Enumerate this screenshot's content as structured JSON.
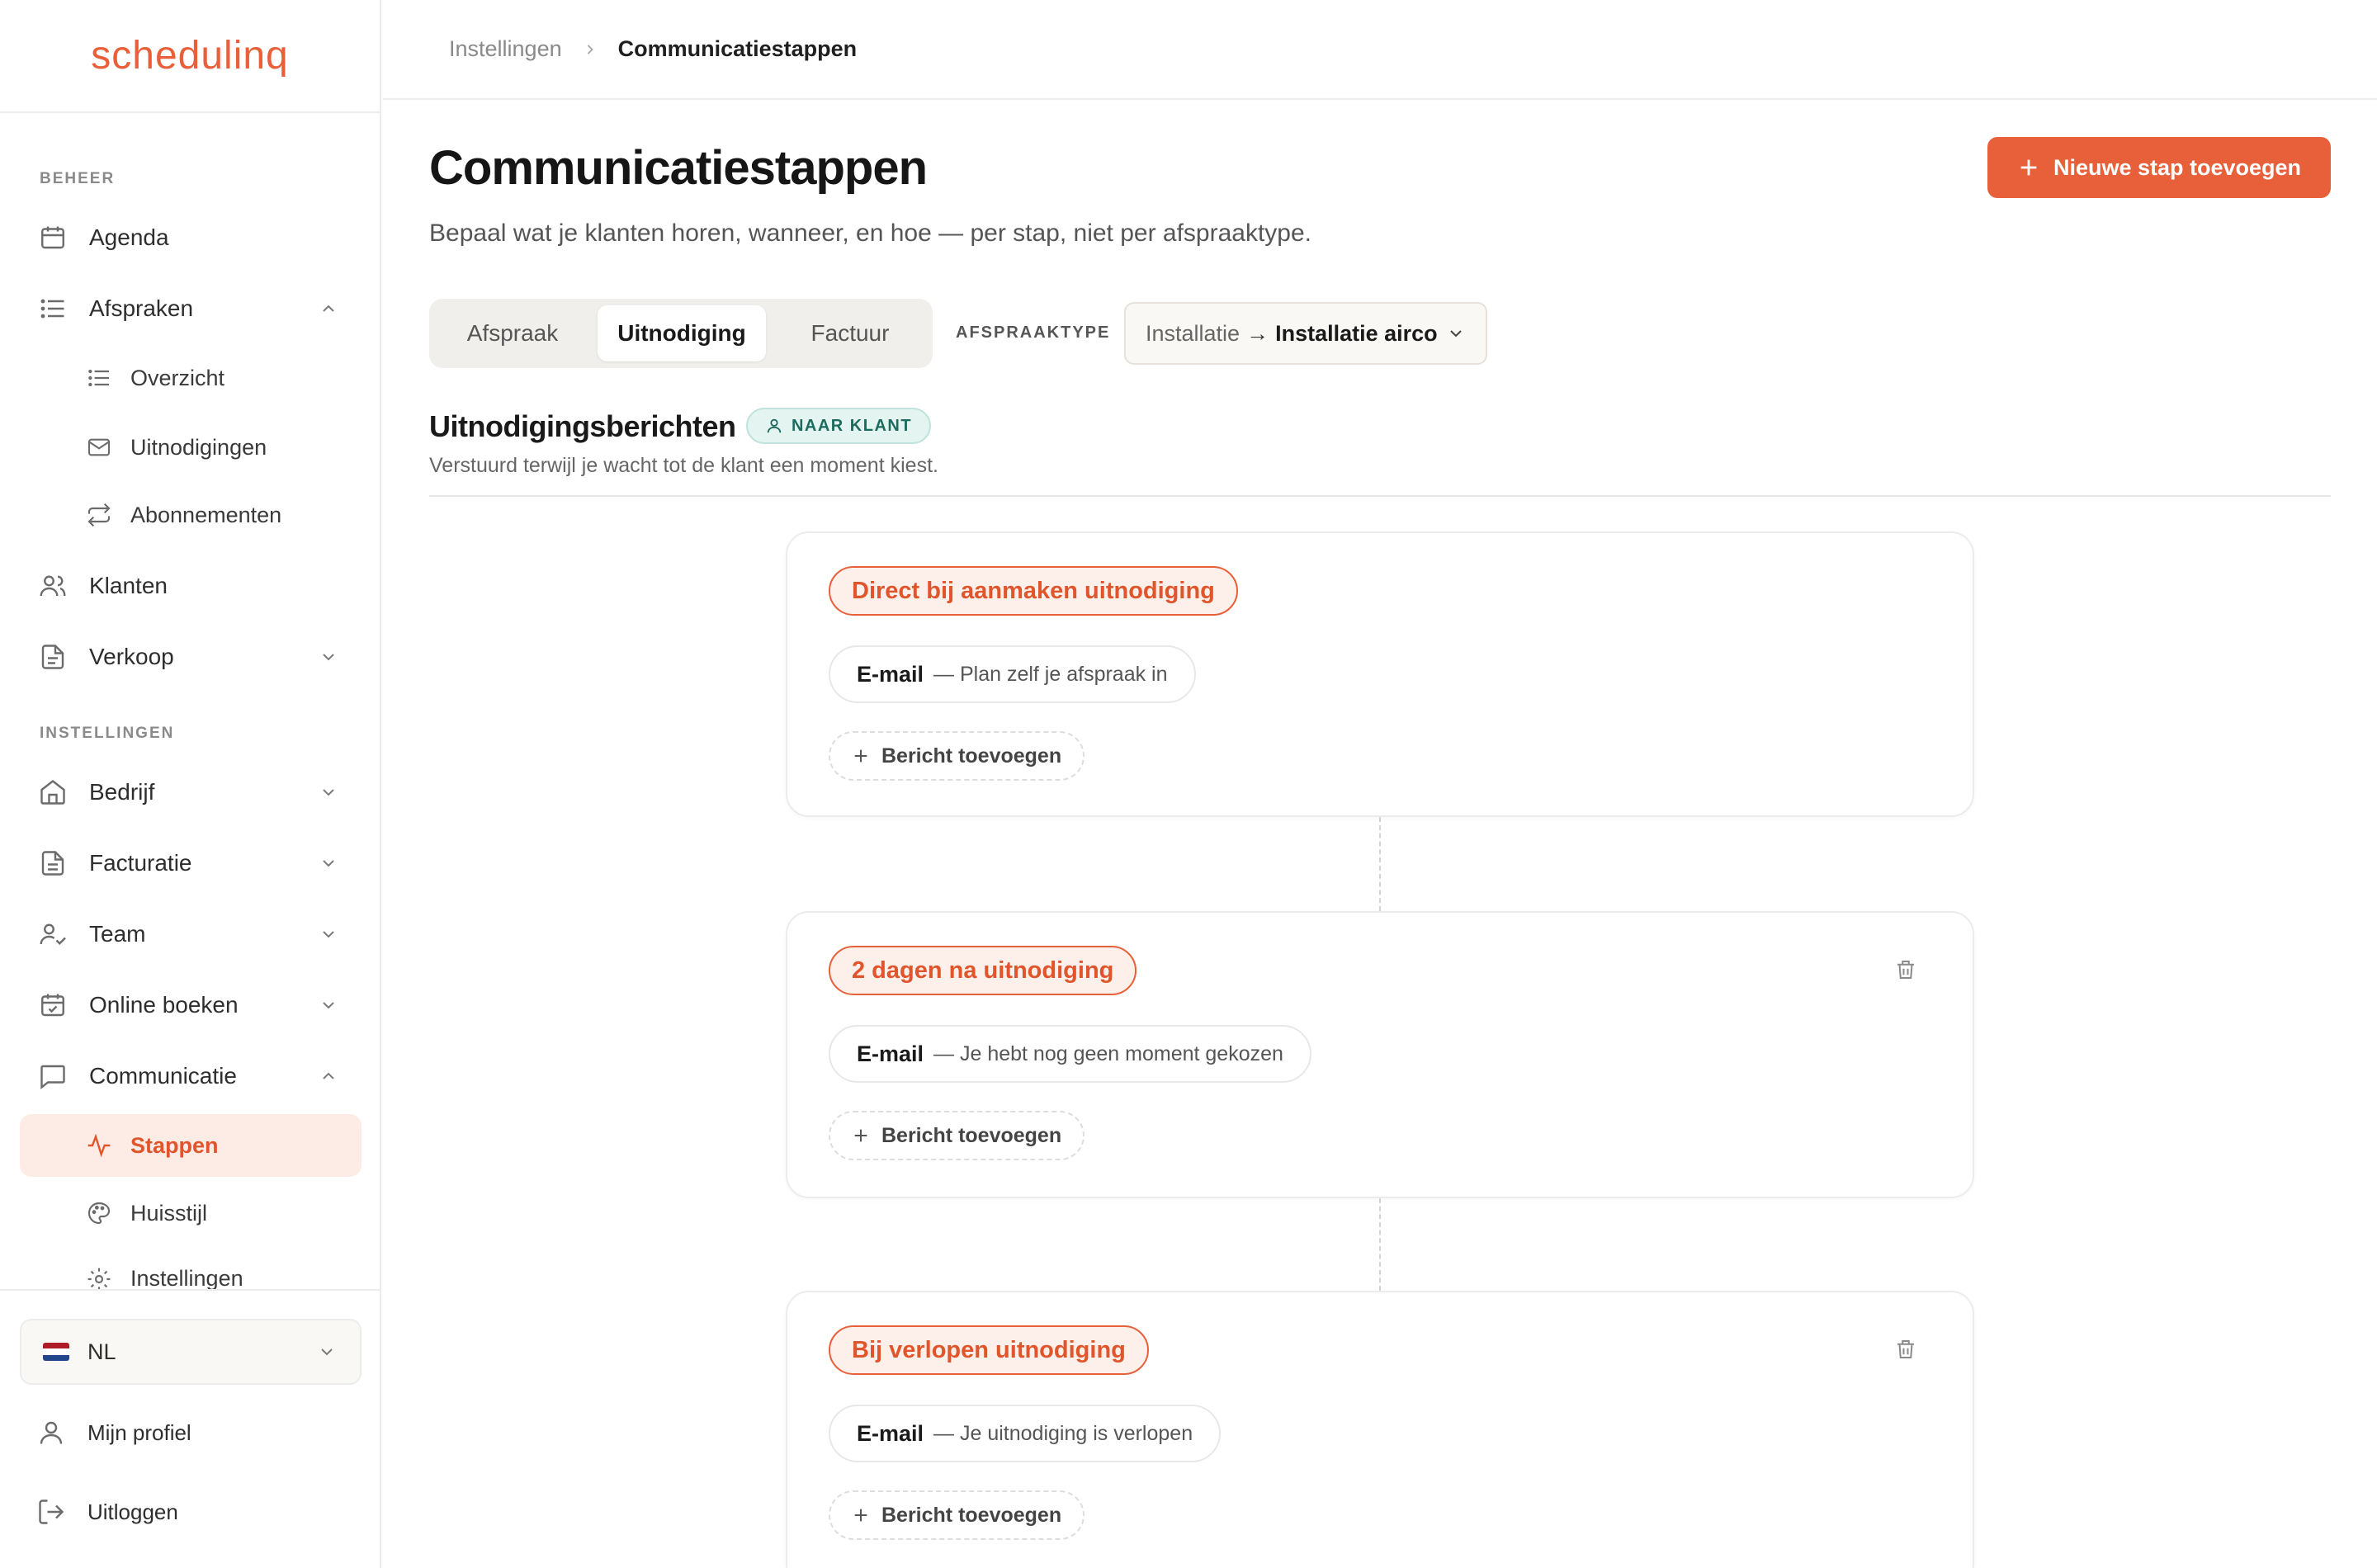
{
  "app": {
    "logo": "schedulinq"
  },
  "sidebar": {
    "sections": {
      "beheer": "BEHEER",
      "instellingen": "INSTELLINGEN"
    },
    "items": {
      "agenda": "Agenda",
      "afspraken": "Afspraken",
      "overzicht": "Overzicht",
      "uitnodigingen": "Uitnodigingen",
      "abonnementen": "Abonnementen",
      "klanten": "Klanten",
      "verkoop": "Verkoop",
      "bedrijf": "Bedrijf",
      "facturatie": "Facturatie",
      "team": "Team",
      "online_boeken": "Online boeken",
      "communicatie": "Communicatie",
      "stappen": "Stappen",
      "huisstijl": "Huisstijl",
      "instellingen": "Instellingen"
    },
    "language": "NL",
    "profile": "Mijn profiel",
    "logout": "Uitloggen"
  },
  "breadcrumb": {
    "parent": "Instellingen",
    "current": "Communicatiestappen"
  },
  "page": {
    "title": "Communicatiestappen",
    "subtitle": "Bepaal wat je klanten horen, wanneer, en hoe — per stap, niet per afspraaktype.",
    "new_step_button": "Nieuwe stap toevoegen"
  },
  "tabs": {
    "afspraak": "Afspraak",
    "uitnodiging": "Uitnodiging",
    "factuur": "Factuur",
    "active": "uitnodiging"
  },
  "appointment_type": {
    "label": "AFSPRAAKTYPE",
    "parent": "Installatie",
    "arrow": "→",
    "child": "Installatie airco"
  },
  "section": {
    "title": "Uitnodigingsberichten",
    "badge": "NAAR KLANT",
    "subtitle": "Verstuurd terwijl je wacht tot de klant een moment kiest."
  },
  "steps": [
    {
      "trigger": "Direct bij aanmaken uitnodiging",
      "channel": "E-mail",
      "message": "— Plan zelf je afspraak in",
      "add_label": "Bericht toevoegen",
      "deletable": false
    },
    {
      "trigger": "2 dagen na uitnodiging",
      "channel": "E-mail",
      "message": "— Je hebt nog geen moment gekozen",
      "add_label": "Bericht toevoegen",
      "deletable": true
    },
    {
      "trigger": "Bij verlopen uitnodiging",
      "channel": "E-mail",
      "message": "— Je uitnodiging is verlopen",
      "add_label": "Bericht toevoegen",
      "deletable": true
    }
  ],
  "colors": {
    "accent": "#e8603a",
    "accent_bg": "#fdece6",
    "teal": "#1d6b5e"
  }
}
